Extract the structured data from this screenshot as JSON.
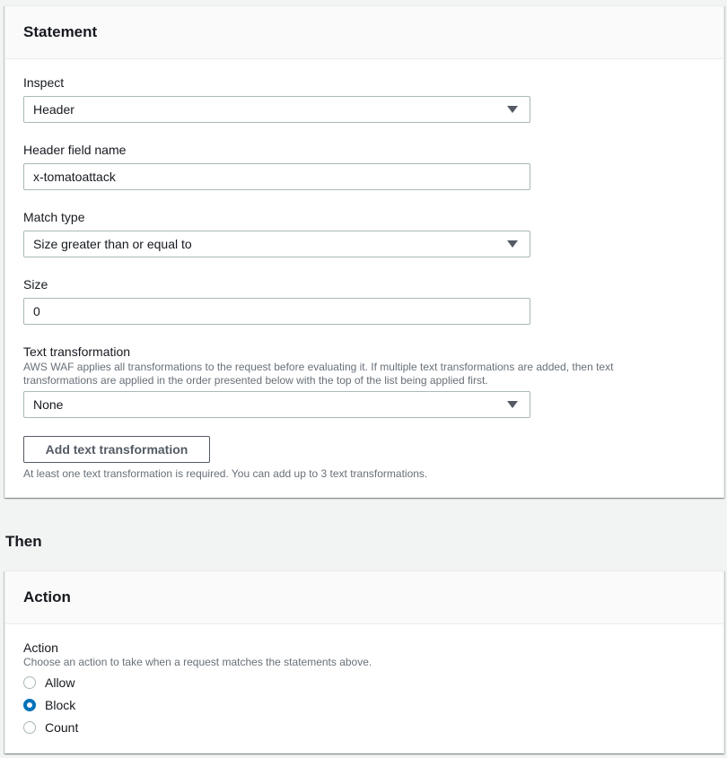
{
  "statement": {
    "title": "Statement",
    "inspect": {
      "label": "Inspect",
      "value": "Header"
    },
    "header_field": {
      "label": "Header field name",
      "value": "x-tomatoattack"
    },
    "match_type": {
      "label": "Match type",
      "value": "Size greater than or equal to"
    },
    "size": {
      "label": "Size",
      "value": "0"
    },
    "text_transformation": {
      "label": "Text transformation",
      "description": "AWS WAF applies all transformations to the request before evaluating it. If multiple text transformations are added, then text transformations are applied in the order presented below with the top of the list being applied first.",
      "value": "None"
    },
    "add_button_label": "Add text transformation",
    "hint": "At least one text transformation is required. You can add up to 3 text transformations."
  },
  "then_heading": "Then",
  "action": {
    "title": "Action",
    "label": "Action",
    "description": "Choose an action to take when a request matches the statements above.",
    "options": [
      {
        "label": "Allow",
        "selected": false
      },
      {
        "label": "Block",
        "selected": true
      },
      {
        "label": "Count",
        "selected": false
      }
    ],
    "accent_color": "#0073bb"
  }
}
